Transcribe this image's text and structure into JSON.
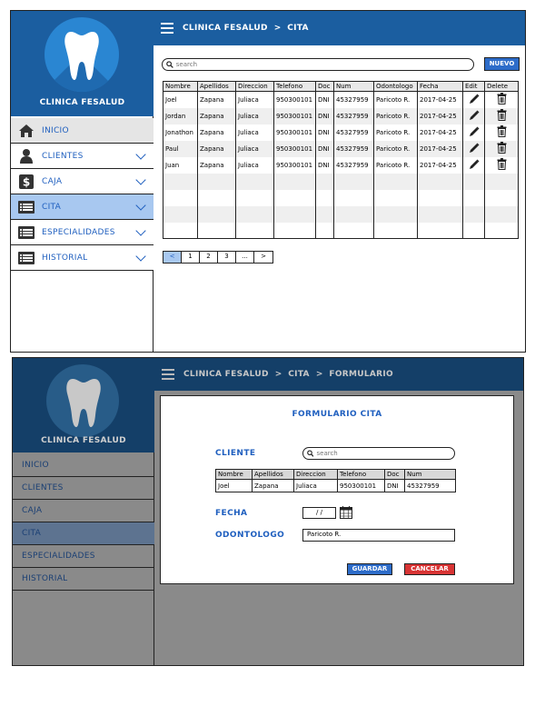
{
  "screen_list": {
    "app_title": "CLINICA FESALUD",
    "breadcrumb": [
      "CLINICA FESALUD",
      "CITA"
    ],
    "breadcrumb_sep": ">",
    "menu": [
      {
        "label": "INICIO",
        "icon": "home-icon"
      },
      {
        "label": "CLIENTES",
        "icon": "user-icon"
      },
      {
        "label": "CAJA",
        "icon": "dollar-icon"
      },
      {
        "label": "CITA",
        "icon": "list-icon"
      },
      {
        "label": "ESPECIALIDADES",
        "icon": "list-icon"
      },
      {
        "label": "HISTORIAL",
        "icon": "list-icon"
      }
    ],
    "active_menu": "CITA",
    "search_placeholder": "search",
    "new_button": "NUEVO",
    "table": {
      "headers": [
        "Nombre",
        "Apellidos",
        "Direccion",
        "Telefono",
        "Doc",
        "Num",
        "Odontologo",
        "Fecha",
        "Edit",
        "Delete"
      ],
      "rows": [
        [
          "Joel",
          "Zapana",
          "Juliaca",
          "950300101",
          "DNI",
          "45327959",
          "Paricoto R.",
          "2017-04-25"
        ],
        [
          "Jordan",
          "Zapana",
          "Juliaca",
          "950300101",
          "DNI",
          "45327959",
          "Paricoto R.",
          "2017-04-25"
        ],
        [
          "Jonathon",
          "Zapana",
          "Juliaca",
          "950300101",
          "DNI",
          "45327959",
          "Paricoto R.",
          "2017-04-25"
        ],
        [
          "Paul",
          "Zapana",
          "Juliaca",
          "950300101",
          "DNI",
          "45327959",
          "Paricoto R.",
          "2017-04-25"
        ],
        [
          "Juan",
          "Zapana",
          "Juliaca",
          "950300101",
          "DNI",
          "45327959",
          "Paricoto R.",
          "2017-04-25"
        ]
      ],
      "empty_rows": 4
    },
    "pagination": [
      "<",
      "1",
      "2",
      "3",
      "...",
      ">"
    ]
  },
  "screen_form": {
    "app_title": "CLINICA FESALUD",
    "breadcrumb": [
      "CLINICA FESALUD",
      "CITA",
      "FORMULARIO"
    ],
    "breadcrumb_sep": ">",
    "menu": [
      "INICIO",
      "CLIENTES",
      "CAJA",
      "CITA",
      "ESPECIALIDADES",
      "HISTORIAL"
    ],
    "form_title": "FORMULARIO CITA",
    "cliente_label": "CLIENTE",
    "search_placeholder": "search",
    "client_table": {
      "headers": [
        "Nombre",
        "Apellidos",
        "Direccion",
        "Telefono",
        "Doc",
        "Num"
      ],
      "row": [
        "Joel",
        "Zapana",
        "Juliaca",
        "950300101",
        "DNI",
        "45327959"
      ]
    },
    "fecha_label": "FECHA",
    "fecha_value": "/ /",
    "odontologo_label": "ODONTOLOGO",
    "odontologo_value": "Paricoto R.",
    "save_button": "GUARDAR",
    "cancel_button": "CANCELAR"
  },
  "colors": {
    "brand": "#1b5ea0",
    "accent": "#2d6cc9",
    "active_menu": "#a8c8f0",
    "danger": "#d83434",
    "overlay": "#8a8a8a"
  }
}
